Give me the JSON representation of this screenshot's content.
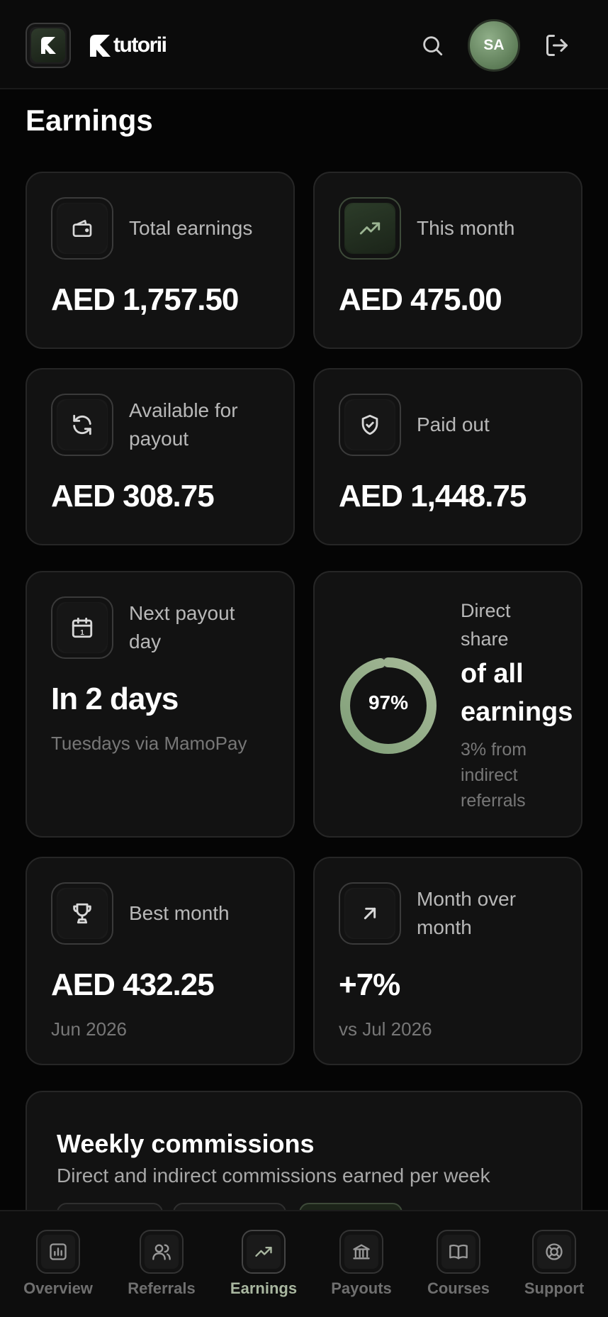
{
  "header": {
    "brand_name": "tutorii",
    "avatar_initials": "SA"
  },
  "page_title": "Earnings",
  "cards": {
    "total_earnings": {
      "label": "Total earnings",
      "value": "AED 1,757.50"
    },
    "this_month": {
      "label": "This month",
      "value": "AED 475.00"
    },
    "available": {
      "label_line1": "Available for",
      "label_line2": "payout",
      "value": "AED 308.75"
    },
    "paid_out": {
      "label": "Paid out",
      "value": "AED 1,448.75"
    },
    "next_payout": {
      "label_line1": "Next payout",
      "label_line2": "day",
      "value": "In 2 days",
      "sub": "Tuesdays via MamoPay"
    },
    "direct_share": {
      "percent_text": "97%",
      "percent_value": 97,
      "label_line1": "Direct",
      "label_line2": "share",
      "headline_line1": "of all",
      "headline_line2": "earnings",
      "sub_line1": "3% from",
      "sub_line2": "indirect",
      "sub_line3": "referrals",
      "ring_color": "#8fa987",
      "track_color": "#2a2a2a"
    },
    "best_month": {
      "label": "Best month",
      "value": "AED 432.25",
      "sub": "Jun 2026"
    },
    "month_over_month": {
      "label_line1": "Month over",
      "label_line2": "month",
      "value": "+7%",
      "sub": "vs Jul 2026"
    }
  },
  "weekly": {
    "title": "Weekly commissions",
    "subtitle": "Direct and indirect commissions earned per week"
  },
  "nav": {
    "items": [
      {
        "label": "Overview",
        "icon": "chart-icon"
      },
      {
        "label": "Referrals",
        "icon": "users-icon"
      },
      {
        "label": "Earnings",
        "icon": "trend-up-icon"
      },
      {
        "label": "Payouts",
        "icon": "bank-icon"
      },
      {
        "label": "Courses",
        "icon": "book-icon"
      },
      {
        "label": "Support",
        "icon": "lifebuoy-icon"
      }
    ],
    "active_index": 2
  },
  "colors": {
    "accent": "#8fa987",
    "background": "#050505",
    "card": "#121212"
  }
}
